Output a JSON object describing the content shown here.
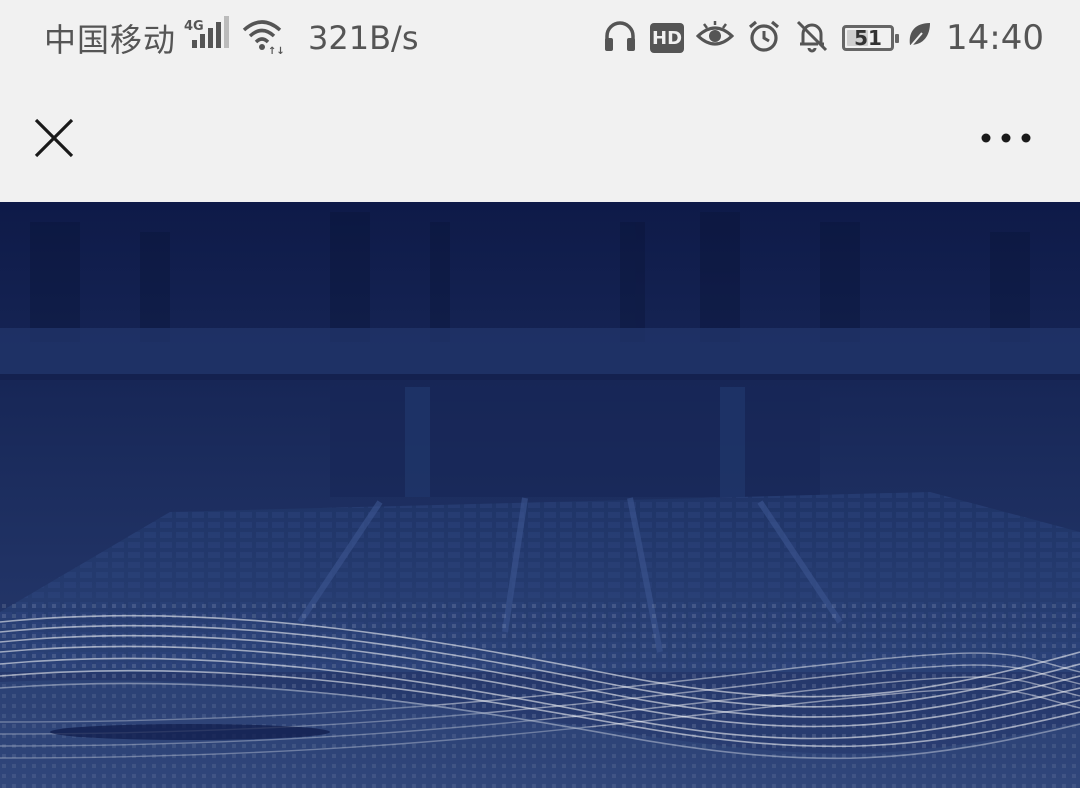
{
  "status_bar": {
    "carrier": "中国移动",
    "network_type": "4G",
    "net_speed": "321B/s",
    "battery_level": 51,
    "battery_text": "51",
    "hd_label": "HD",
    "time": "14:40",
    "icons": [
      "signal-icon",
      "wifi-icon",
      "headphones-icon",
      "hd-icon",
      "eye-icon",
      "alarm-icon",
      "bell-off-icon",
      "battery-icon",
      "leaf-icon"
    ]
  },
  "nav": {
    "close_icon": "close-icon",
    "more_icon": "more-icon"
  },
  "hero": {
    "theme_color": "#1c2f64",
    "accent_color": "#0e1a48"
  }
}
